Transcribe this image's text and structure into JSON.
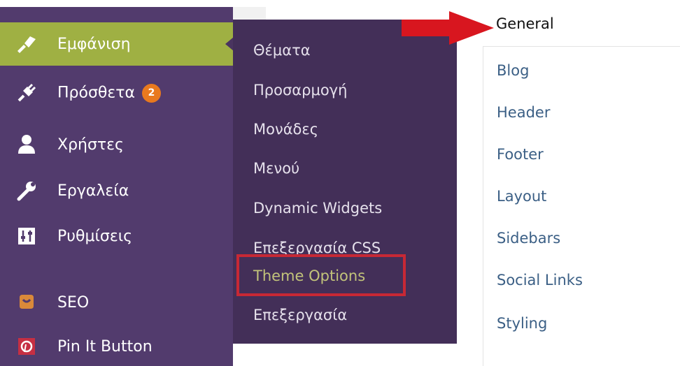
{
  "colors": {
    "menu_bg": "#523b6d",
    "submenu_bg": "#432f58",
    "current_item_bg": "#9fb043",
    "badge_bg": "#e8791e",
    "highlight_border": "#c72835",
    "arrow_color": "#d8161f",
    "link_color": "#3b5f85"
  },
  "admin_menu": {
    "items": [
      {
        "label": "Εμφάνιση",
        "icon": "paintbrush-icon"
      },
      {
        "label": "Πρόσθετα",
        "icon": "plugin-icon",
        "badge": "2"
      },
      {
        "label": "Χρήστες",
        "icon": "user-icon"
      },
      {
        "label": "Εργαλεία",
        "icon": "wrench-icon"
      },
      {
        "label": "Ρυθμίσεις",
        "icon": "settings-sliders-icon"
      },
      {
        "label": "SEO",
        "icon": "seo-icon"
      },
      {
        "label": "Pin It Button",
        "icon": "pinterest-icon"
      }
    ]
  },
  "submenu": {
    "items": [
      "Θέματα",
      "Προσαρμογή",
      "Μονάδες",
      "Μενού",
      "Dynamic Widgets",
      "Επεξεργασία CSS",
      "Theme Options",
      "Επεξεργασία"
    ]
  },
  "theme_options_tabs": {
    "active": "General",
    "items": [
      "Blog",
      "Header",
      "Footer",
      "Layout",
      "Sidebars",
      "Social Links",
      "Styling"
    ]
  }
}
